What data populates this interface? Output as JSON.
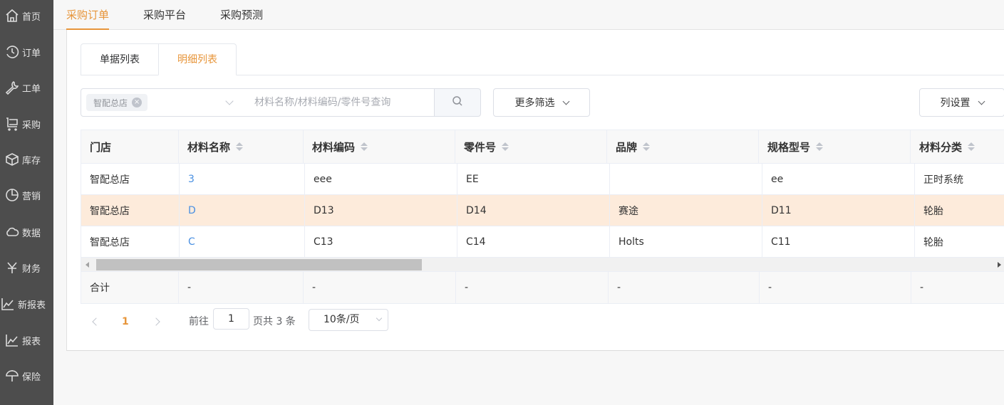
{
  "sidebar": {
    "items": [
      {
        "label": "首页",
        "icon": "home-icon"
      },
      {
        "label": "订单",
        "icon": "history-icon"
      },
      {
        "label": "工单",
        "icon": "wrench-icon"
      },
      {
        "label": "采购",
        "icon": "cart-icon"
      },
      {
        "label": "库存",
        "icon": "box-icon"
      },
      {
        "label": "营销",
        "icon": "pie-chart-icon"
      },
      {
        "label": "数据",
        "icon": "cloud-icon"
      },
      {
        "label": "财务",
        "icon": "yen-icon"
      },
      {
        "label": "新报表",
        "icon": "line-chart-icon"
      },
      {
        "label": "报表",
        "icon": "line-chart-icon"
      },
      {
        "label": "保险",
        "icon": "umbrella-icon"
      }
    ]
  },
  "top_tabs": [
    {
      "label": "采购订单",
      "active": true
    },
    {
      "label": "采购平台",
      "active": false
    },
    {
      "label": "采购预测",
      "active": false
    }
  ],
  "sub_tabs": [
    {
      "label": "单据列表",
      "active": false
    },
    {
      "label": "明细列表",
      "active": true
    }
  ],
  "filters": {
    "store_tag": "智配总店",
    "search_placeholder": "材料名称/材料编码/零件号查询",
    "search_value": "",
    "more_filters_label": "更多筛选",
    "column_settings_label": "列设置"
  },
  "table": {
    "columns": [
      "门店",
      "材料名称",
      "材料编码",
      "零件号",
      "品牌",
      "规格型号",
      "材料分类"
    ],
    "rows": [
      {
        "store": "智配总店",
        "name": "3",
        "code": "eee",
        "part_no": "EE",
        "brand": "",
        "spec": "ee",
        "category": "正时系统",
        "highlighted": false
      },
      {
        "store": "智配总店",
        "name": "D",
        "code": "D13",
        "part_no": "D14",
        "brand": "赛途",
        "spec": "D11",
        "category": "轮胎",
        "highlighted": true
      },
      {
        "store": "智配总店",
        "name": "C",
        "code": "C13",
        "part_no": "C14",
        "brand": "Holts",
        "spec": "C11",
        "category": "轮胎",
        "highlighted": false
      }
    ],
    "footer": [
      "合计",
      "-",
      "-",
      "-",
      "-",
      "-",
      "-"
    ]
  },
  "pagination": {
    "current_page": "1",
    "goto_label": "前往",
    "goto_value": "1",
    "total_label": "页共 3 条",
    "page_size": "10条/页"
  },
  "colors": {
    "accent": "#e7953a",
    "link": "#4a90e2",
    "highlight_row": "#fdebdb",
    "sidebar_bg": "#4d4d4d"
  }
}
